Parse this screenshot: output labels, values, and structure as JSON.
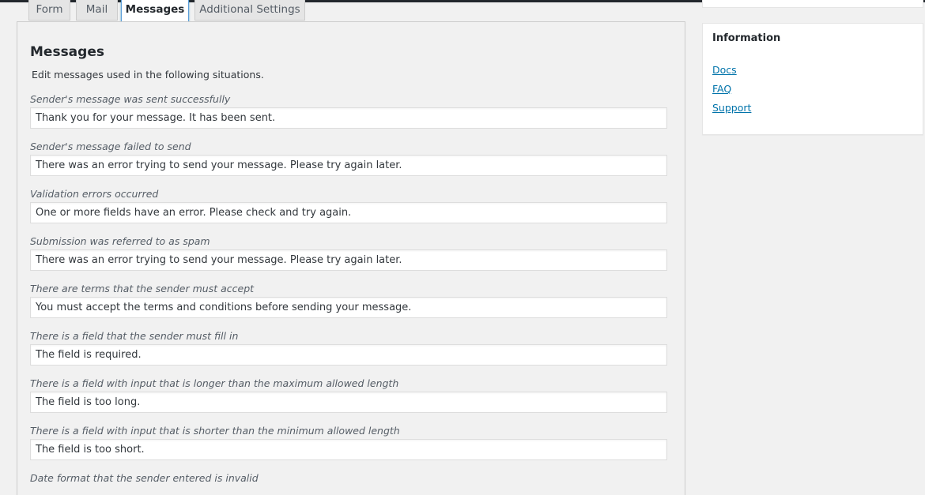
{
  "tabs": [
    {
      "label": "Form"
    },
    {
      "label": "Mail"
    },
    {
      "label": "Messages",
      "active": true
    },
    {
      "label": "Additional Settings"
    }
  ],
  "panel": {
    "title": "Messages",
    "description": "Edit messages used in the following situations."
  },
  "fields": [
    {
      "label": "Sender's message was sent successfully",
      "value": "Thank you for your message. It has been sent."
    },
    {
      "label": "Sender's message failed to send",
      "value": "There was an error trying to send your message. Please try again later."
    },
    {
      "label": "Validation errors occurred",
      "value": "One or more fields have an error. Please check and try again."
    },
    {
      "label": "Submission was referred to as spam",
      "value": "There was an error trying to send your message. Please try again later."
    },
    {
      "label": "There are terms that the sender must accept",
      "value": "You must accept the terms and conditions before sending your message."
    },
    {
      "label": "There is a field that the sender must fill in",
      "value": "The field is required."
    },
    {
      "label": "There is a field with input that is longer than the maximum allowed length",
      "value": "The field is too long."
    },
    {
      "label": "There is a field with input that is shorter than the minimum allowed length",
      "value": "The field is too short."
    },
    {
      "label": "Date format that the sender entered is invalid",
      "value": ""
    }
  ],
  "sidebar": {
    "title": "Information",
    "links": [
      "Docs",
      "FAQ",
      "Support"
    ]
  },
  "colors": {
    "link": "#0073aa",
    "active_tab_border": "#5b9dd9",
    "background": "#f1f1f1"
  }
}
